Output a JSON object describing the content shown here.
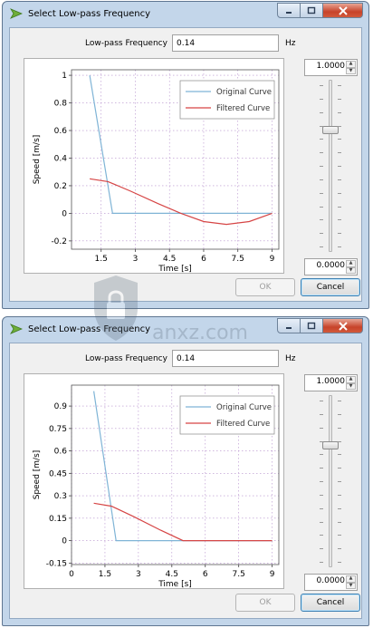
{
  "dialogs": [
    {
      "title": "Select Low-pass Frequency",
      "frequency_label": "Low-pass Frequency",
      "frequency_value": "0.14",
      "unit_label": "Hz",
      "spin_top": "1.0000",
      "spin_bottom": "0.0000",
      "slider_level": 0.72,
      "ok_label": "OK",
      "cancel_label": "Cancel"
    },
    {
      "title": "Select Low-pass Frequency",
      "frequency_label": "Low-pass Frequency",
      "frequency_value": "0.14",
      "unit_label": "Hz",
      "spin_top": "1.0000",
      "spin_bottom": "0.0000",
      "slider_level": 0.72,
      "ok_label": "OK",
      "cancel_label": "Cancel"
    }
  ],
  "chart_data": [
    {
      "type": "line",
      "xlabel": "Time [s]",
      "ylabel": "Speed [m/s]",
      "xlim": [
        0.2,
        9.3
      ],
      "ylim": [
        -0.26,
        1.04
      ],
      "xticks": [
        1.5,
        3,
        4.5,
        6,
        7.5,
        9
      ],
      "xtick_labels": [
        "1.5",
        "3",
        "4.5",
        "6",
        "7.5",
        "9"
      ],
      "yticks": [
        1,
        0.8,
        0.6,
        0.4,
        0.2,
        0,
        -0.2
      ],
      "ytick_labels": [
        "1",
        "0.8",
        "0.6",
        "0.4",
        "0.2",
        "0",
        "-0.2"
      ],
      "grid": true,
      "legend": "top-right",
      "series": [
        {
          "name": "Original Curve",
          "color": "#7fb4d6",
          "x": [
            1,
            2,
            9
          ],
          "y": [
            1,
            0,
            0
          ]
        },
        {
          "name": "Filtered Curve",
          "color": "#d64545",
          "x": [
            1,
            1.8,
            2.8,
            4,
            5,
            6,
            7,
            8,
            9
          ],
          "y": [
            0.25,
            0.23,
            0.16,
            0.07,
            0,
            -0.06,
            -0.08,
            -0.06,
            0
          ]
        }
      ]
    },
    {
      "type": "line",
      "xlabel": "Time [s]",
      "ylabel": "Speed [m/s]",
      "xlim": [
        0,
        9.3
      ],
      "ylim": [
        -0.16,
        1.04
      ],
      "xticks": [
        0,
        1.5,
        3,
        4.5,
        6,
        7.5,
        9
      ],
      "xtick_labels": [
        "0",
        "1.5",
        "3",
        "4.5",
        "6",
        "7.5",
        "9"
      ],
      "yticks": [
        0.9,
        0.75,
        0.6,
        0.45,
        0.3,
        0.15,
        0,
        -0.15
      ],
      "ytick_labels": [
        "0.9",
        "0.75",
        "0.6",
        "0.45",
        "0.3",
        "0.15",
        "0",
        "-0.15"
      ],
      "grid": true,
      "legend": "top-right",
      "series": [
        {
          "name": "Original Curve",
          "color": "#7fb4d6",
          "x": [
            1,
            2,
            9
          ],
          "y": [
            1,
            0,
            0
          ]
        },
        {
          "name": "Filtered Curve",
          "color": "#d64545",
          "x": [
            1,
            1.8,
            2.8,
            4,
            5,
            6,
            7,
            8,
            9
          ],
          "y": [
            0.25,
            0.23,
            0.16,
            0.07,
            0,
            0,
            0,
            0,
            0
          ]
        }
      ]
    }
  ],
  "watermark": {
    "brand_text": "anxz.com"
  }
}
